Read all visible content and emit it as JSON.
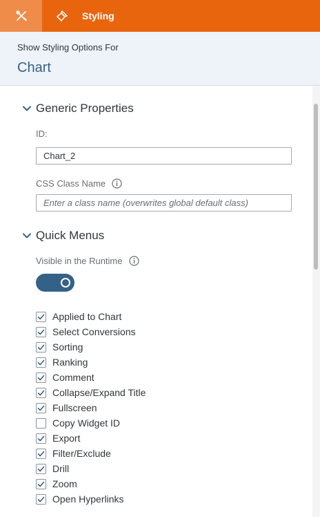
{
  "toolbar": {
    "tools_icon": "tools-icon",
    "styling_icon": "brush-icon",
    "styling_label": "Styling",
    "accent_color": "#e8650e"
  },
  "header": {
    "subtitle": "Show Styling Options For",
    "title": "Chart"
  },
  "generic_properties": {
    "section_label": "Generic Properties",
    "id_label": "ID:",
    "id_value": "Chart_2",
    "css_label": "CSS Class Name",
    "css_placeholder": "Enter a class name (overwrites global default class)"
  },
  "quick_menus": {
    "section_label": "Quick Menus",
    "visible_label": "Visible in the Runtime",
    "visible_on": true,
    "items": [
      {
        "label": "Applied to Chart",
        "checked": true
      },
      {
        "label": "Select Conversions",
        "checked": true
      },
      {
        "label": "Sorting",
        "checked": true
      },
      {
        "label": "Ranking",
        "checked": true
      },
      {
        "label": "Comment",
        "checked": true
      },
      {
        "label": "Collapse/Expand Title",
        "checked": true
      },
      {
        "label": "Fullscreen",
        "checked": true
      },
      {
        "label": "Copy Widget ID",
        "checked": false
      },
      {
        "label": "Export",
        "checked": true
      },
      {
        "label": "Filter/Exclude",
        "checked": true
      },
      {
        "label": "Drill",
        "checked": true
      },
      {
        "label": "Zoom",
        "checked": true
      },
      {
        "label": "Open Hyperlinks",
        "checked": true
      }
    ]
  }
}
